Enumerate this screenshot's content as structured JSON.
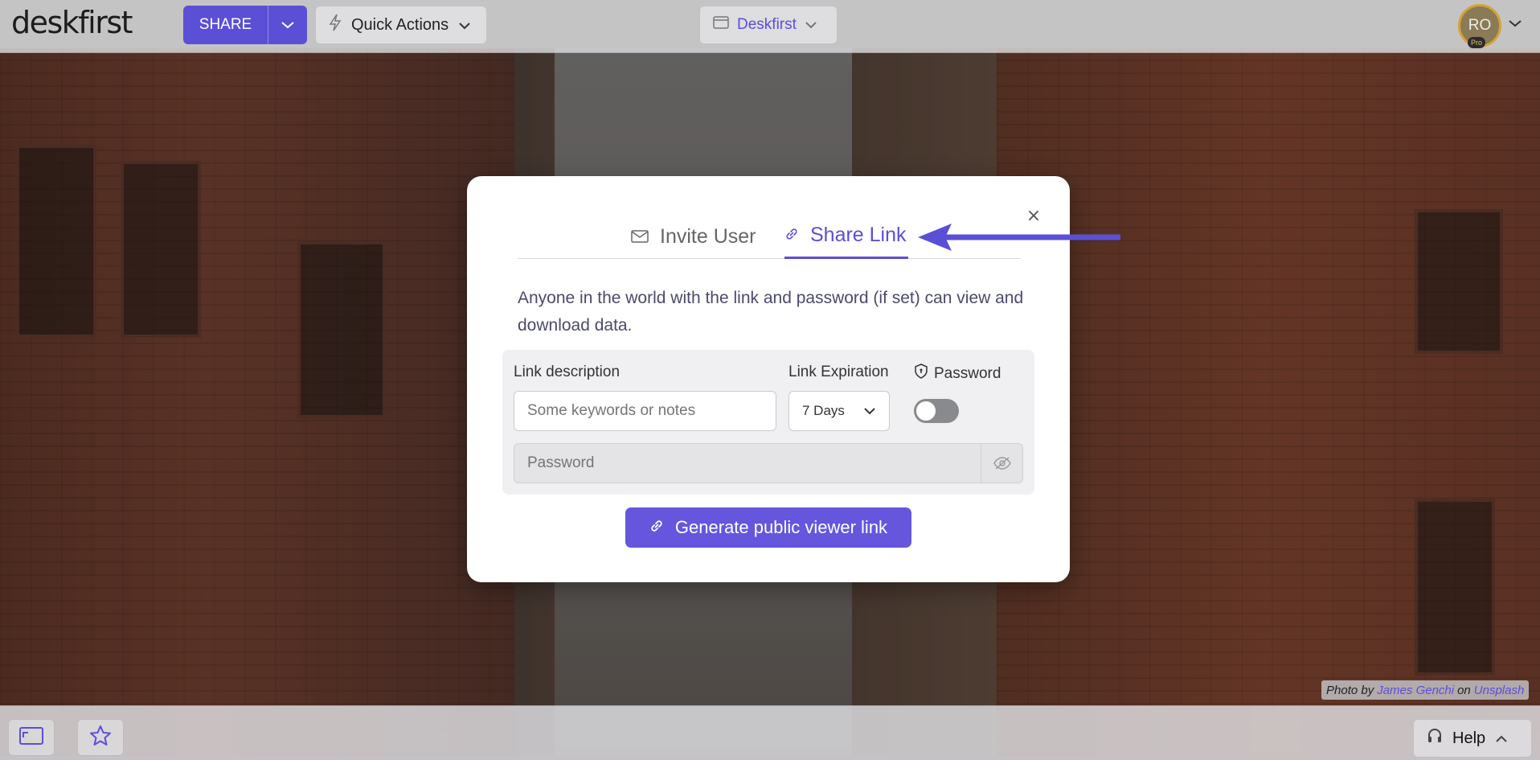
{
  "app": {
    "logo_text": "deskfirst"
  },
  "toolbar": {
    "share_label": "SHARE",
    "quick_actions_label": "Quick Actions",
    "workspace_label": "Deskfirst",
    "avatar_initials": "RO",
    "avatar_badge": "Pro"
  },
  "modal": {
    "tabs": [
      {
        "label": "Invite User",
        "icon": "envelope-icon",
        "active": false
      },
      {
        "label": "Share Link",
        "icon": "link-icon",
        "active": true
      }
    ],
    "description": "Anyone in the world with the link and password (if set) can view and download data.",
    "link_description_label": "Link description",
    "link_description_placeholder": "Some keywords or notes",
    "link_expiration_label": "Link Expiration",
    "link_expiration_value": "7 Days",
    "password_label": "Password",
    "password_toggle_on": false,
    "password_placeholder": "Password",
    "generate_button_label": "Generate public viewer link",
    "close_glyph": "×"
  },
  "bottombar": {
    "help_label": "Help"
  },
  "credit": {
    "prefix": "Photo by",
    "author": "James Genchi",
    "middle": "on",
    "site": "Unsplash"
  },
  "colors": {
    "accent": "#5b4fd6",
    "button": "#6656dd",
    "toggle_off": "#888a8e"
  }
}
